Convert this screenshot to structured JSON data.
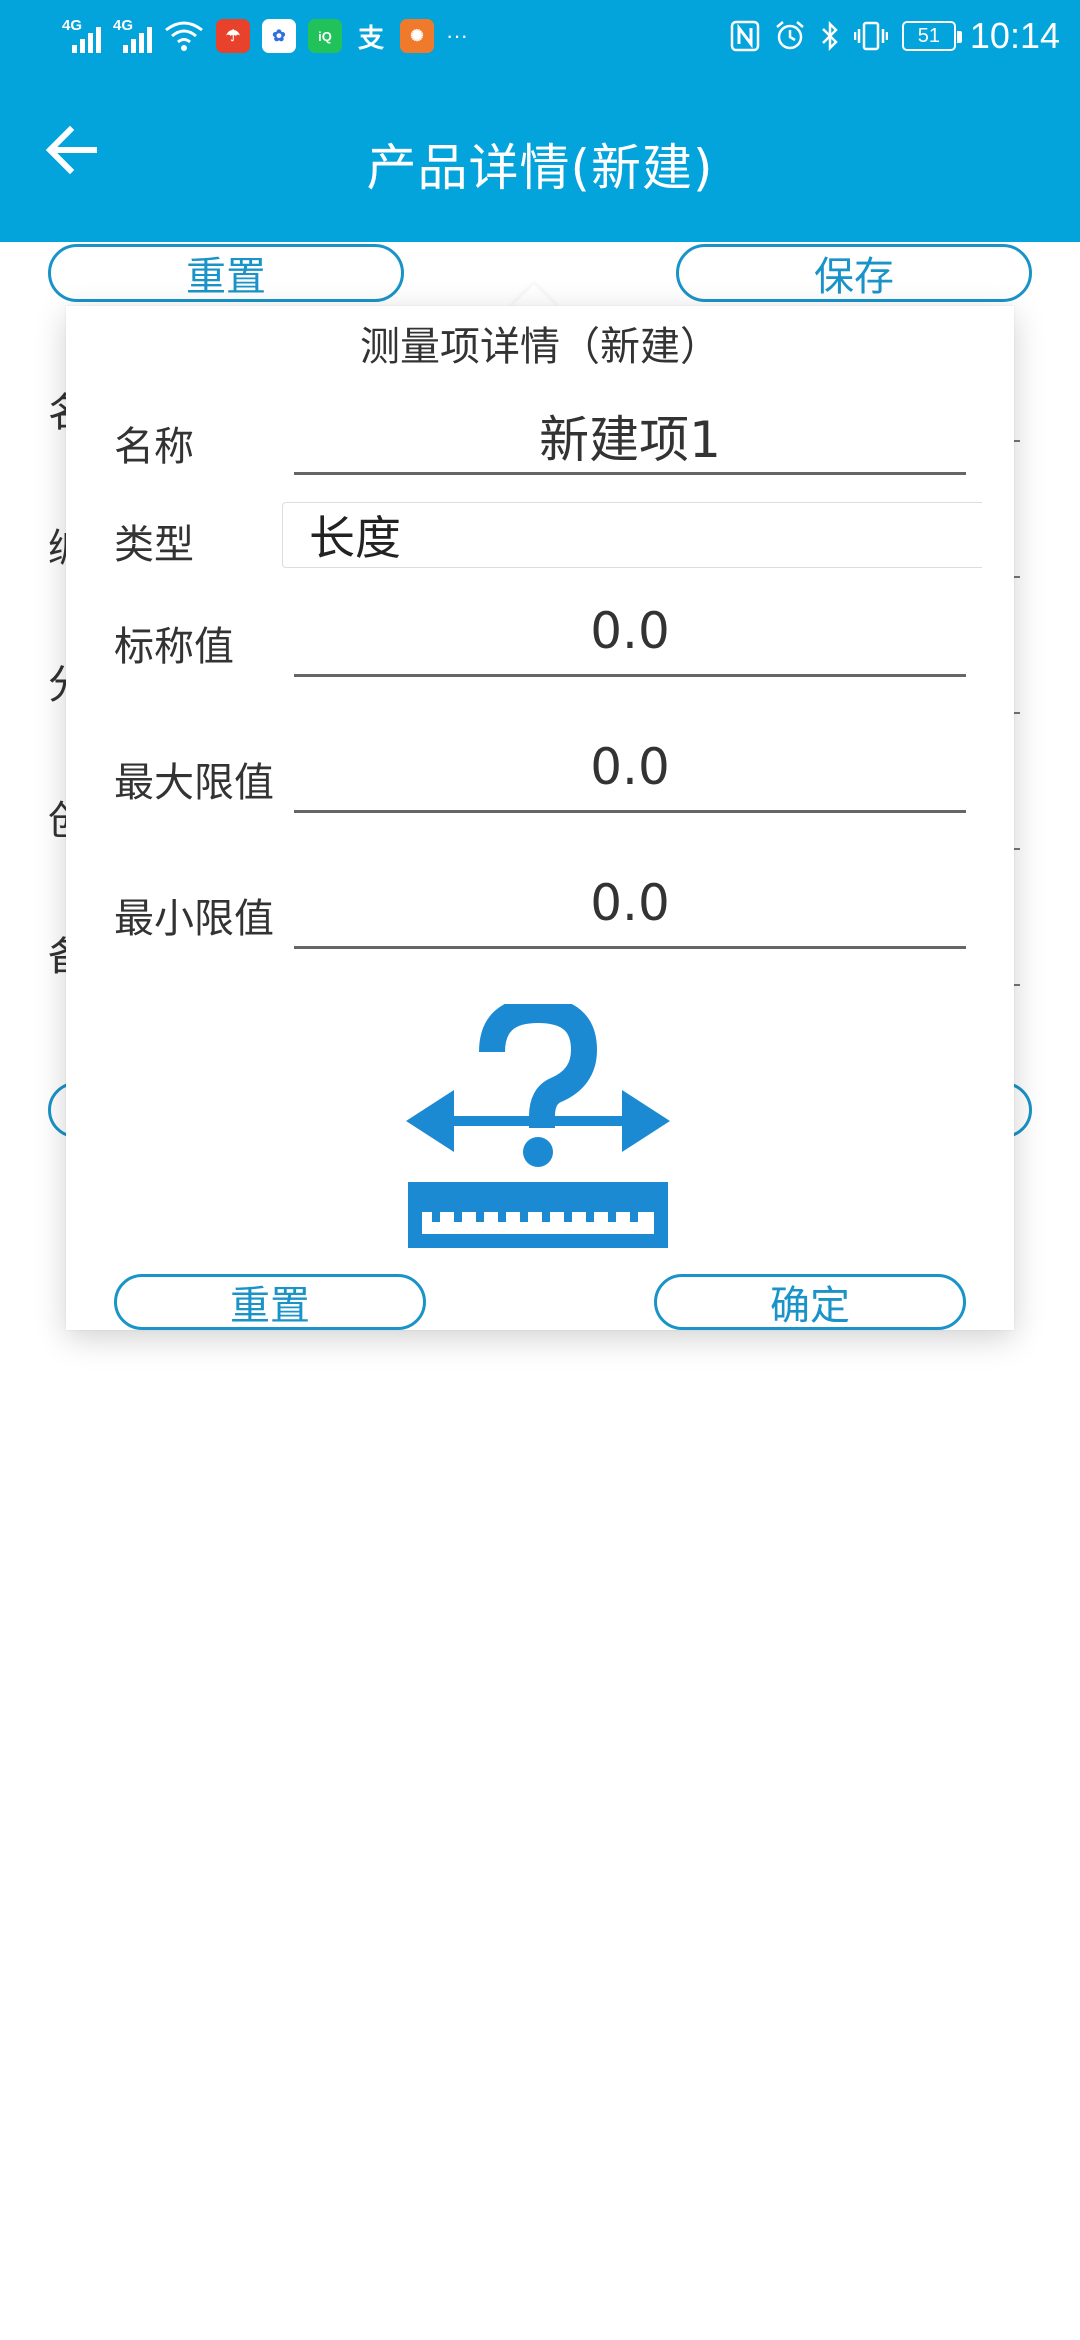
{
  "status_bar": {
    "network1": "4G",
    "network2": "4G",
    "more": "···",
    "battery": "51",
    "time": "10:14",
    "icons": [
      "signal-icon",
      "wifi-icon",
      "app-notify-icons",
      "nfc-icon",
      "alarm-icon",
      "bluetooth-icon",
      "vibrate-icon",
      "battery-icon"
    ]
  },
  "app_bar": {
    "title": "产品详情(新建)",
    "back_icon": "arrow-left-icon"
  },
  "background_page": {
    "reset_label": "重置",
    "save_label": "保存",
    "row_labels": [
      "名",
      "编",
      "分",
      "创",
      "备"
    ]
  },
  "dialog": {
    "title": "测量项详情（新建）",
    "fields": {
      "name_label": "名称",
      "name_value": "新建项1",
      "type_label": "类型",
      "type_value": "长度",
      "nominal_label": "标称值",
      "nominal_value": "0.0",
      "max_label": "最大限值",
      "max_value": "0.0",
      "min_label": "最小限值",
      "min_value": "0.0"
    },
    "illustration_icon": "ruler-question-icon",
    "reset_label": "重置",
    "confirm_label": "确定"
  },
  "colors": {
    "primary": "#03a3dc",
    "button_outline": "#1a93c8",
    "illustration": "#1b8ad3"
  }
}
